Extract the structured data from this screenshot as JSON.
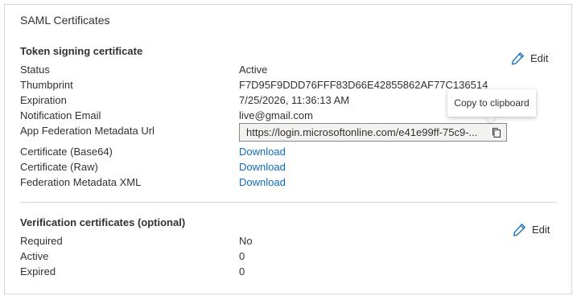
{
  "card": {
    "title": "SAML Certificates"
  },
  "token_signing": {
    "title": "Token signing certificate",
    "edit_label": "Edit",
    "rows": [
      {
        "label": "Status",
        "value": "Active"
      },
      {
        "label": "Thumbprint",
        "value": "F7D95F9DDD76FFF83D66E42855862AF77C136514"
      },
      {
        "label": "Expiration",
        "value": "7/25/2026, 11:36:13 AM"
      },
      {
        "label": "Notification Email",
        "value": "live@gmail.com"
      },
      {
        "label": "App Federation Metadata Url",
        "value": "https://login.microsoftonline.com/e41e99ff-75c9-..."
      },
      {
        "label": "Certificate (Base64)",
        "value": "Download"
      },
      {
        "label": "Certificate (Raw)",
        "value": "Download"
      },
      {
        "label": "Federation Metadata XML",
        "value": "Download"
      }
    ],
    "copy_icon": "copy-icon",
    "tooltip": "Copy to clipboard"
  },
  "verification": {
    "title": "Verification certificates (optional)",
    "edit_label": "Edit",
    "rows": [
      {
        "label": "Required",
        "value": "No"
      },
      {
        "label": "Active",
        "value": "0"
      },
      {
        "label": "Expired",
        "value": "0"
      }
    ]
  },
  "colors": {
    "link": "#0f6cbd",
    "edit_icon": "#0f6cbd",
    "border": "#d6d6d6",
    "text": "#323130"
  }
}
